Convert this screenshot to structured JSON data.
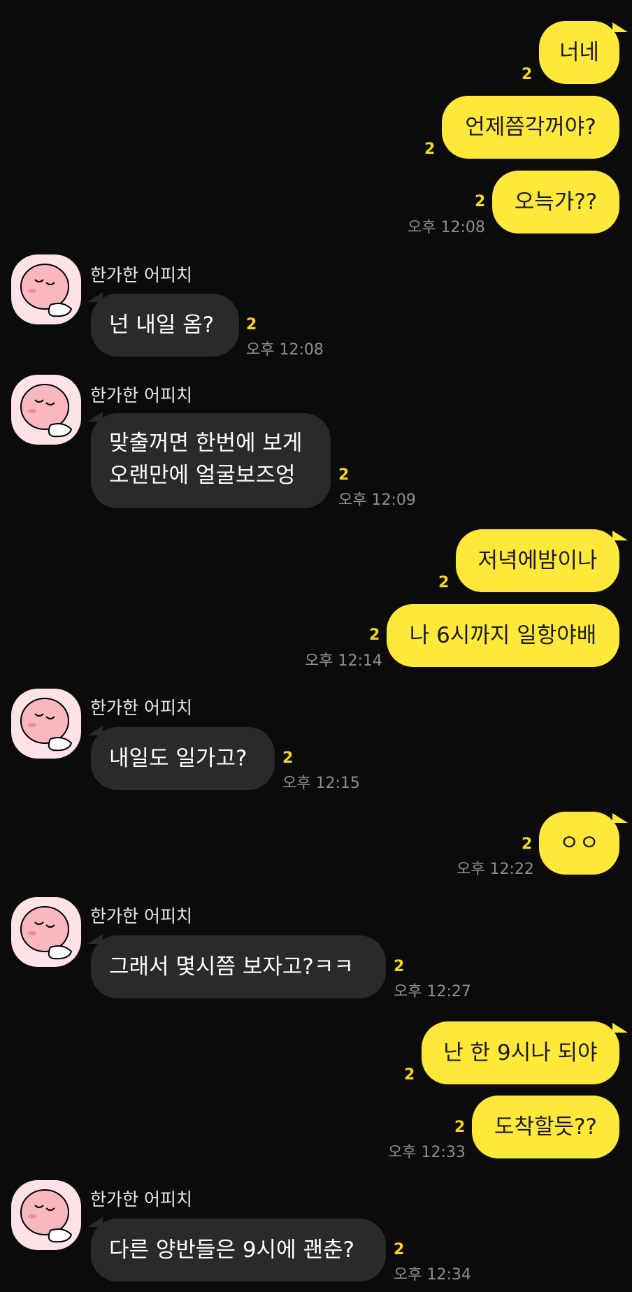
{
  "chat": {
    "sender_name": "한가한 어피치",
    "unread": "2",
    "messages": [
      {
        "from": "me",
        "text": "너네"
      },
      {
        "from": "me",
        "text": "언제쯤각꺼야?"
      },
      {
        "from": "me",
        "text": "오늑가??",
        "time": "오후 12:08"
      },
      {
        "from": "other",
        "text": "넌 내일 옴?",
        "time": "오후 12:08"
      },
      {
        "from": "other",
        "lines": [
          "맞출꺼면 한번에 보게",
          "오랜만에 얼굴보즈엉"
        ],
        "time": "오후 12:09"
      },
      {
        "from": "me",
        "text": "저녁에밤이나"
      },
      {
        "from": "me",
        "text": "나 6시까지 일항야배",
        "time": "오후 12:14"
      },
      {
        "from": "other",
        "text": "내일도 일가고?",
        "time": "오후 12:15"
      },
      {
        "from": "me",
        "text": "ㅇㅇ",
        "time": "오후 12:22"
      },
      {
        "from": "other",
        "text": "그래서 몇시쯤 보자고?ㅋㅋ",
        "time": "오후 12:27"
      },
      {
        "from": "me",
        "text": "난 한 9시나 되야"
      },
      {
        "from": "me",
        "text": "도착할듯??",
        "time": "오후 12:33"
      },
      {
        "from": "other",
        "text": "다른 양반들은 9시에 괜춘?",
        "time": "오후 12:34"
      }
    ]
  },
  "colors": {
    "background": "#0b0b0b",
    "my_bubble": "#fee83a",
    "other_bubble": "#2a2a2a",
    "unread_count": "#f7d617",
    "timestamp": "#8f8f8f"
  },
  "icons": {
    "avatar": "apeach-sleeping-avatar-icon"
  }
}
